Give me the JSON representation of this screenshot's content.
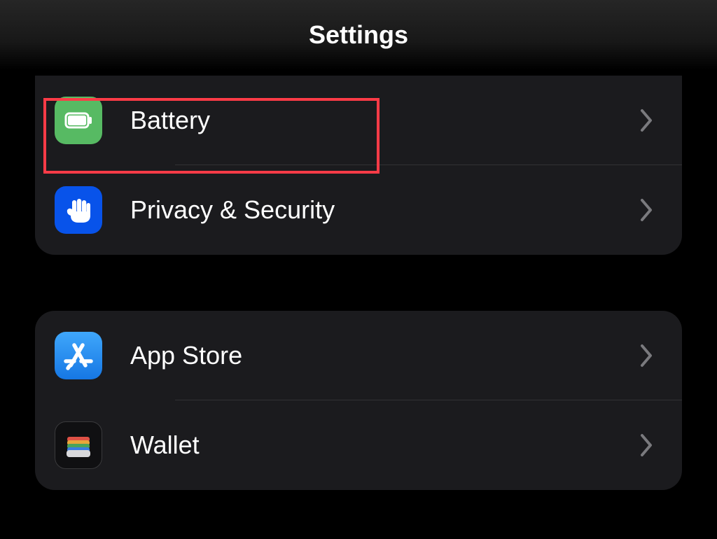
{
  "header": {
    "title": "Settings"
  },
  "groups": [
    {
      "items": [
        {
          "id": "battery",
          "label": "Battery",
          "icon": "battery-icon",
          "tile": "tile-green",
          "highlighted": true
        },
        {
          "id": "privacy",
          "label": "Privacy & Security",
          "icon": "hand-icon",
          "tile": "tile-blue",
          "highlighted": false
        }
      ]
    },
    {
      "items": [
        {
          "id": "appstore",
          "label": "App Store",
          "icon": "appstore-icon",
          "tile": "tile-appstore",
          "highlighted": false
        },
        {
          "id": "wallet",
          "label": "Wallet",
          "icon": "wallet-icon",
          "tile": "tile-wallet",
          "highlighted": false
        }
      ]
    }
  ],
  "colors": {
    "highlight": "#ff3b47",
    "groupBg": "#1b1b1e",
    "chevron": "#7a7a7e"
  }
}
